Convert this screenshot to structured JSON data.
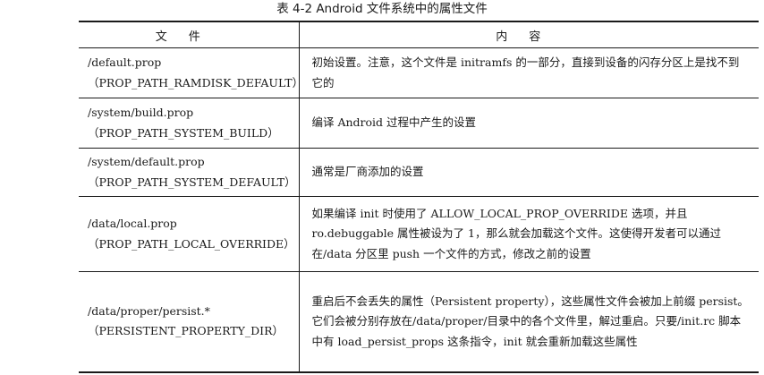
{
  "caption": "表 4-2   Android 文件系统中的属性文件",
  "table": {
    "headers": [
      "文件",
      "内容"
    ],
    "rows": [
      {
        "path": "/default.prop",
        "constant": "（PROP_PATH_RAMDISK_DEFAULT）",
        "content": "初始设置。注意，这个文件是 initramfs 的一部分，直接到设备的闪存分区上是找不到它的"
      },
      {
        "path": "/system/build.prop",
        "constant": "（PROP_PATH_SYSTEM_BUILD）",
        "content": "编译 Android 过程中产生的设置"
      },
      {
        "path": "/system/default.prop",
        "constant": "（PROP_PATH_SYSTEM_DEFAULT）",
        "content": "通常是厂商添加的设置"
      },
      {
        "path": "/data/local.prop",
        "constant": "（PROP_PATH_LOCAL_OVERRIDE）",
        "content": "如果编译 init 时使用了 ALLOW_LOCAL_PROP_OVERRIDE 选项，并且 ro.debuggable 属性被设为了 1，那么就会加载这个文件。这使得开发者可以通过在/data 分区里 push 一个文件的方式，修改之前的设置"
      },
      {
        "path": "/data/proper/persist.*",
        "constant": "（PERSISTENT_PROPERTY_DIR）",
        "content": "重启后不会丢失的属性（Persistent property），这些属性文件会被加上前缀 persist。它们会被分别存放在/data/proper/目录中的各个文件里，解过重启。只要/init.rc 脚本中有 load_persist_props 这条指令，init 就会重新加载这些属性"
      }
    ]
  }
}
